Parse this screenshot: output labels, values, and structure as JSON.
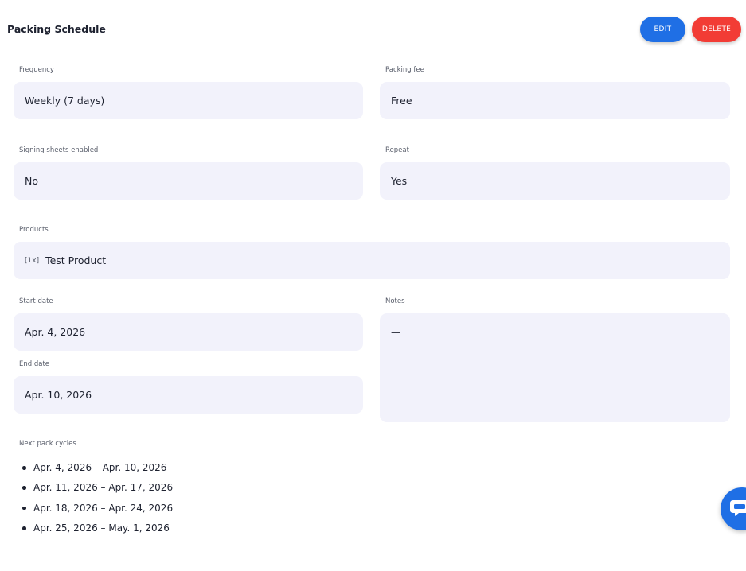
{
  "header": {
    "title": "Packing Schedule",
    "edit_label": "EDIT",
    "delete_label": "DELETE"
  },
  "fields": {
    "frequency": {
      "label": "Frequency",
      "value": "Weekly (7 days)"
    },
    "packing_fee": {
      "label": "Packing fee",
      "value": "Free"
    },
    "signing_sheets": {
      "label": "Signing sheets enabled",
      "value": "No"
    },
    "repeat": {
      "label": "Repeat",
      "value": "Yes"
    },
    "products": {
      "label": "Products",
      "items": [
        {
          "qty": "[1x]",
          "name": "Test Product"
        }
      ]
    },
    "start_date": {
      "label": "Start date",
      "value": "Apr. 4, 2026"
    },
    "end_date": {
      "label": "End date",
      "value": "Apr. 10, 2026"
    },
    "notes": {
      "label": "Notes",
      "value": "—"
    }
  },
  "next_cycles": {
    "label": "Next pack cycles",
    "items": [
      "Apr. 4, 2026 – Apr. 10, 2026",
      "Apr. 11, 2026 – Apr. 17, 2026",
      "Apr. 18, 2026 – Apr. 24, 2026",
      "Apr. 25, 2026 – May. 1, 2026"
    ]
  },
  "colors": {
    "accent": "#1f6fe5",
    "danger": "#f23c35",
    "field_bg": "#f2f2fb"
  },
  "icons": {
    "chat": "chat-bubble-icon"
  }
}
